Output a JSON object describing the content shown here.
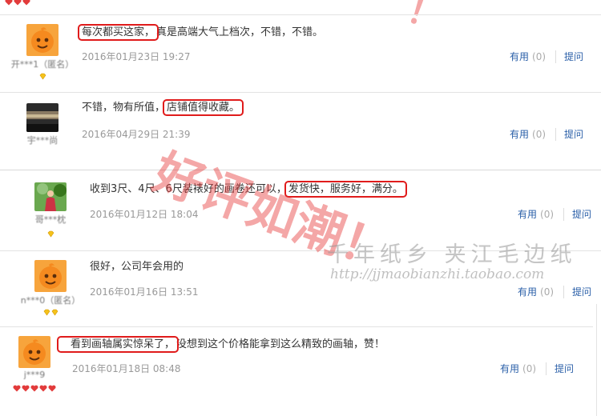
{
  "reviews": [
    {
      "user": "开***1（匿名）",
      "content_highlight": "每次都买这家，",
      "content_rest": "真是高端大气上档次，不错，不错。",
      "date": "2016年01月23日 19:27",
      "useful_label": "有用",
      "useful_count": "(0)",
      "ask_label": "提问"
    },
    {
      "user": "宇***尚",
      "content_pre": "不错，物有所值，",
      "content_highlight": "店铺值得收藏。",
      "date": "2016年04月29日 21:39",
      "useful_label": "有用",
      "useful_count": "(0)",
      "ask_label": "提问"
    },
    {
      "user": "哥***枕",
      "content_pre": "收到3尺、4尺、6尺装裱好的画卷还可以，",
      "content_highlight": "发货快，服务好，满分。",
      "date": "2016年01月12日 18:04",
      "useful_label": "有用",
      "useful_count": "(0)",
      "ask_label": "提问"
    },
    {
      "user": "n***0（匿名）",
      "content_rest": "很好，公司年会用的",
      "date": "2016年01月16日 13:51",
      "useful_label": "有用",
      "useful_count": "(0)",
      "ask_label": "提问"
    },
    {
      "user": "j***9",
      "content_highlight": "看到画轴属实惊呆了，",
      "content_rest": "没想到这个价格能拿到这么精致的画轴，赞！",
      "date": "2016年01月18日 08:48",
      "useful_label": "有用",
      "useful_count": "(0)",
      "ask_label": "提问"
    }
  ],
  "watermark": {
    "stamp": "好评如潮！",
    "top_fragment": "！",
    "shop_name": "千年纸乡 夹江毛边纸",
    "shop_url": "http://jjmaobianzhi.taobao.com"
  },
  "colors": {
    "highlight_border": "#e01b1b",
    "link": "#2a5fa8",
    "meta_text": "#999999",
    "watermark_red": "#e63c3c"
  }
}
